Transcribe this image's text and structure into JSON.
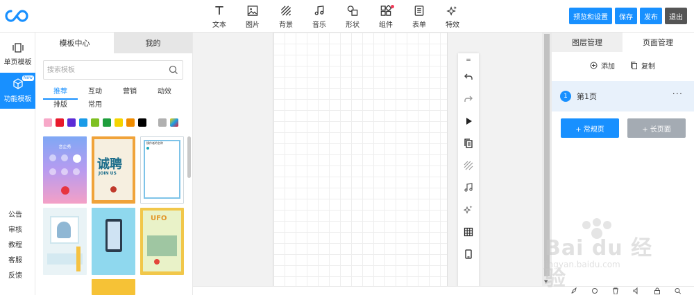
{
  "app": {
    "logo_icon": "infinity-logo-icon"
  },
  "toolbar": {
    "tools": [
      {
        "label": "文本",
        "icon": "text-icon"
      },
      {
        "label": "图片",
        "icon": "image-icon"
      },
      {
        "label": "背景",
        "icon": "background-icon"
      },
      {
        "label": "音乐",
        "icon": "music-icon"
      },
      {
        "label": "形状",
        "icon": "shape-icon"
      },
      {
        "label": "组件",
        "icon": "component-icon",
        "badge": true
      },
      {
        "label": "表单",
        "icon": "form-icon"
      },
      {
        "label": "特效",
        "icon": "sparkle-icon"
      }
    ],
    "actions": {
      "preview": "预览和设置",
      "save": "保存",
      "publish": "发布",
      "exit": "退出"
    }
  },
  "rail": {
    "items": [
      {
        "label": "单页模板",
        "icon": "single-page-icon"
      },
      {
        "label": "功能模板",
        "icon": "cube-icon",
        "badge": "New"
      }
    ],
    "links": [
      "公告",
      "审核",
      "教程",
      "客服",
      "反馈"
    ]
  },
  "templates": {
    "tabs": [
      "模板中心",
      "我的"
    ],
    "search_placeholder": "搜索模板",
    "categories_row1": [
      "推荐",
      "互动",
      "营销",
      "动效"
    ],
    "categories_row2": [
      "排版",
      "常用"
    ],
    "swatches": [
      "#f7a8c8",
      "#e8192c",
      "#5b2bd6",
      "#1a9be8",
      "#7ec022",
      "#1e9e3c",
      "#f5d400",
      "#f08c00",
      "#000000",
      "#b0b0b0"
    ],
    "thumb_texts": {
      "t1_title": "音企秀",
      "t2_big": "诚聘",
      "t2_en": "JOIN US",
      "t3_title": "操作者的名称",
      "t6_title": "UFO"
    }
  },
  "pages": {
    "tabs": [
      "图层管理",
      "页面管理"
    ],
    "add": "添加",
    "copy": "复制",
    "list": [
      {
        "num": "1",
        "name": "第1页"
      }
    ],
    "add_normal": "+ 常规页",
    "add_long": "+ 长页面"
  },
  "watermark": {
    "text": "Bai du 经验",
    "sub": "jingyan.baidu.com"
  }
}
